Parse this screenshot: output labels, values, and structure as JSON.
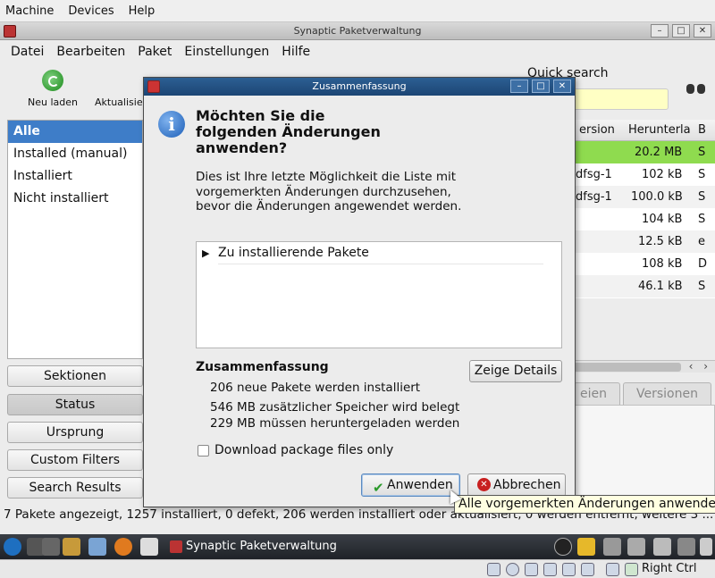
{
  "host_menu": [
    "Machine",
    "Devices",
    "Help"
  ],
  "main_window": {
    "title": "Synaptic Paketverwaltung",
    "menu": [
      "Datei",
      "Bearbeiten",
      "Paket",
      "Einstellungen",
      "Hilfe"
    ],
    "toolbar": {
      "reload": "Neu laden",
      "update": "Aktualisie",
      "quick_search_label": "Quick search",
      "quick_search_value": ""
    },
    "filters": [
      "Alle",
      "Installed (manual)",
      "Installiert",
      "Nicht installiert"
    ],
    "side_buttons": [
      "Sektionen",
      "Status",
      "Ursprung",
      "Custom Filters",
      "Search Results"
    ],
    "table": {
      "headers": [
        "ersion",
        "Herunterla",
        "B"
      ],
      "rows": [
        {
          "version": "",
          "size": "20.2 MB",
          "extra": "S"
        },
        {
          "version": "dfsg-1",
          "size": "102 kB",
          "extra": "S"
        },
        {
          "version": "dfsg-1",
          "size": "100.0 kB",
          "extra": "S"
        },
        {
          "version": "",
          "size": "104 kB",
          "extra": "S"
        },
        {
          "version": "",
          "size": "12.5 kB",
          "extra": "e"
        },
        {
          "version": "",
          "size": "108 kB",
          "extra": "D"
        },
        {
          "version": "",
          "size": "46.1 kB",
          "extra": "S"
        }
      ]
    },
    "tabs": [
      "eien",
      "Versionen"
    ],
    "statusbar": "7 Pakete angezeigt, 1257 installiert, 0 defekt, 206 werden installiert oder aktualisiert, 0 werden entfernt, weitere 3 ..."
  },
  "dialog": {
    "title": "Zusammenfassung",
    "heading": "Möchten Sie die folgenden Änderungen anwenden?",
    "text": "Dies ist Ihre letzte Möglichkeit die Liste mit vorgemerkten Änderungen durchzusehen, bevor die Änderungen angewendet werden.",
    "tree_item": "Zu installierende Pakete",
    "summary_title": "Zusammenfassung",
    "summary_lines": [
      "206 neue Pakete werden installiert",
      "546 MB zusätzlicher Speicher wird belegt",
      "229 MB müssen heruntergeladen werden"
    ],
    "details_button": "Zeige Details",
    "checkbox_label": "Download package files only",
    "checkbox_checked": false,
    "apply_button": "Anwenden",
    "cancel_button": "Abbrechen"
  },
  "tooltip": "Alle vorgemerkten Änderungen anwenden",
  "taskbar": {
    "task": "Synaptic Paketverwaltung"
  },
  "host_status": {
    "hotkey": "Right Ctrl"
  },
  "colors": {
    "selection": "#3e7dc8",
    "dialog_title": "#1c4574",
    "highlight_row": "#8fdb4f",
    "quick_search_bg": "#ffffc4"
  }
}
